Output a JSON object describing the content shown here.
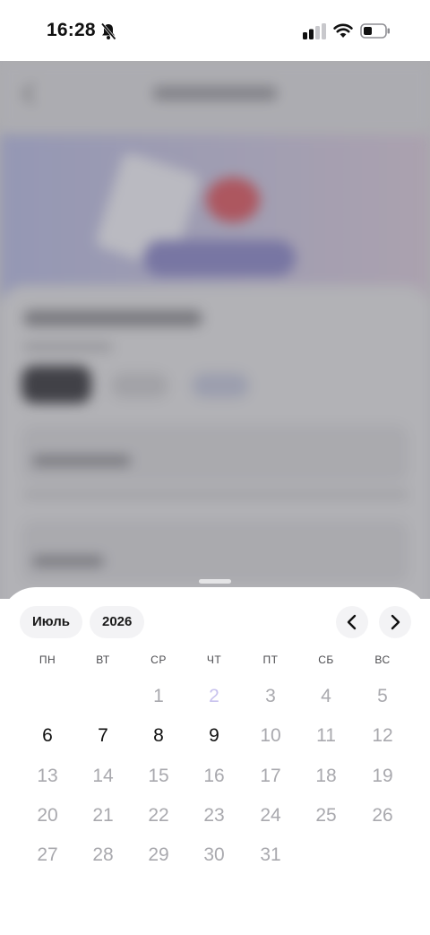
{
  "status_bar": {
    "time": "16:28",
    "icons": [
      "bell-off-icon",
      "signal-icon",
      "wifi-icon",
      "battery-icon"
    ]
  },
  "calendar": {
    "month": "Июль",
    "year": "2026",
    "weekdays": [
      "ПН",
      "ВТ",
      "СР",
      "ЧТ",
      "ПТ",
      "СБ",
      "ВС"
    ],
    "weeks": [
      [
        null,
        null,
        {
          "day": "1",
          "state": "disabled"
        },
        {
          "day": "2",
          "state": "today"
        },
        {
          "day": "3",
          "state": "disabled"
        },
        {
          "day": "4",
          "state": "disabled"
        },
        {
          "day": "5",
          "state": "disabled"
        }
      ],
      [
        {
          "day": "6",
          "state": "enabled"
        },
        {
          "day": "7",
          "state": "enabled"
        },
        {
          "day": "8",
          "state": "enabled"
        },
        {
          "day": "9",
          "state": "enabled"
        },
        {
          "day": "10",
          "state": "disabled"
        },
        {
          "day": "11",
          "state": "disabled"
        },
        {
          "day": "12",
          "state": "disabled"
        }
      ],
      [
        {
          "day": "13",
          "state": "disabled"
        },
        {
          "day": "14",
          "state": "disabled"
        },
        {
          "day": "15",
          "state": "disabled"
        },
        {
          "day": "16",
          "state": "disabled"
        },
        {
          "day": "17",
          "state": "disabled"
        },
        {
          "day": "18",
          "state": "disabled"
        },
        {
          "day": "19",
          "state": "disabled"
        }
      ],
      [
        {
          "day": "20",
          "state": "disabled"
        },
        {
          "day": "21",
          "state": "disabled"
        },
        {
          "day": "22",
          "state": "disabled"
        },
        {
          "day": "23",
          "state": "disabled"
        },
        {
          "day": "24",
          "state": "disabled"
        },
        {
          "day": "25",
          "state": "disabled"
        },
        {
          "day": "26",
          "state": "disabled"
        }
      ],
      [
        {
          "day": "27",
          "state": "disabled"
        },
        {
          "day": "28",
          "state": "disabled"
        },
        {
          "day": "29",
          "state": "disabled"
        },
        {
          "day": "30",
          "state": "disabled"
        },
        {
          "day": "31",
          "state": "disabled"
        },
        null,
        null
      ]
    ],
    "nav_icons": [
      "chevron-left-icon",
      "chevron-right-icon"
    ]
  },
  "colors": {
    "today": "#c8c2ee",
    "enabled": "#111111",
    "disabled": "#a9a9ae",
    "pill_bg": "#f3f3f5"
  }
}
